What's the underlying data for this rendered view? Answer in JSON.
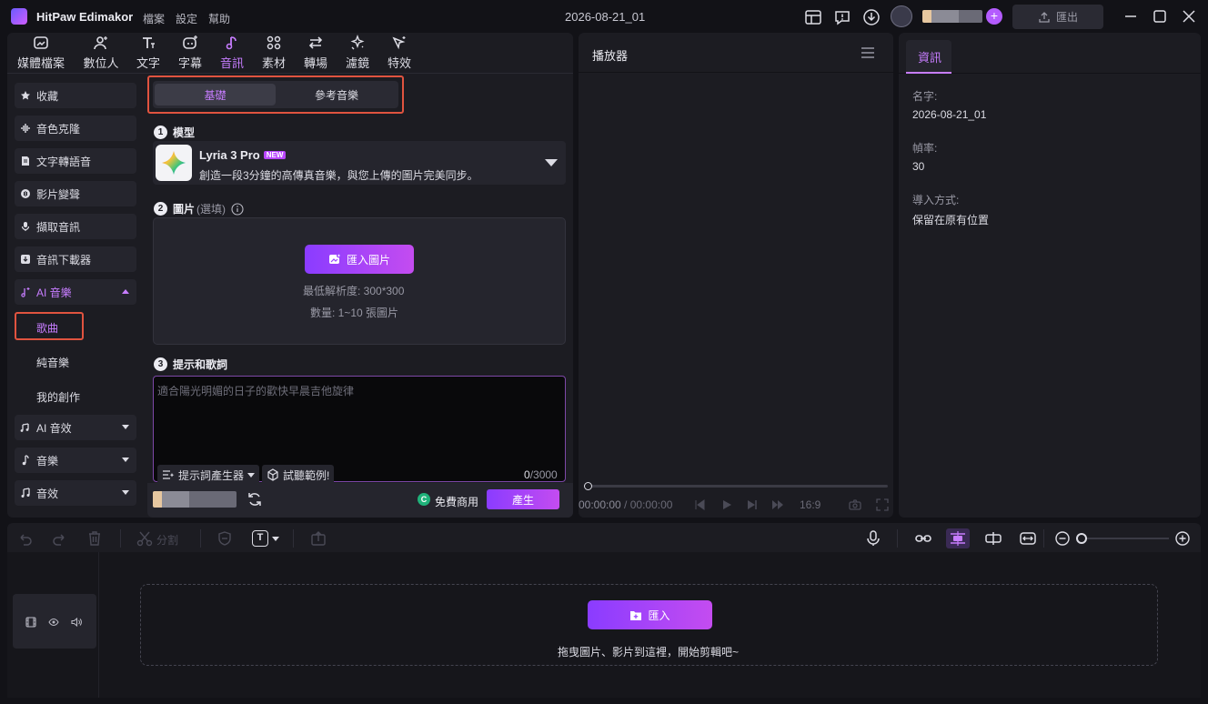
{
  "titlebar": {
    "app_name": "HitPaw Edimakor",
    "menus": [
      "檔案",
      "設定",
      "幫助"
    ],
    "project_name": "2026-08-21_01",
    "export_label": "匯出"
  },
  "tabs": [
    {
      "label": "媒體檔案",
      "icon": "media-icon"
    },
    {
      "label": "數位人",
      "icon": "avatar-person-icon"
    },
    {
      "label": "文字",
      "icon": "text-icon"
    },
    {
      "label": "字幕",
      "icon": "subtitle-icon"
    },
    {
      "label": "音訊",
      "icon": "music-note-icon",
      "active": true
    },
    {
      "label": "素材",
      "icon": "elements-icon"
    },
    {
      "label": "轉場",
      "icon": "transition-icon"
    },
    {
      "label": "濾鏡",
      "icon": "filter-icon"
    },
    {
      "label": "特效",
      "icon": "effects-icon"
    }
  ],
  "sidebar": {
    "items": [
      {
        "label": "收藏",
        "icon": "star-icon"
      },
      {
        "label": "音色克隆",
        "icon": "waveform-icon"
      },
      {
        "label": "文字轉語音",
        "icon": "text-to-speech-icon"
      },
      {
        "label": "影片變聲",
        "icon": "voice-change-icon"
      },
      {
        "label": "擷取音訊",
        "icon": "microphone-icon"
      },
      {
        "label": "音訊下載器",
        "icon": "download-icon"
      },
      {
        "label": "AI 音樂",
        "icon": "ai-music-icon"
      },
      {
        "label": "AI 音效",
        "icon": "ai-sfx-icon"
      },
      {
        "label": "音樂",
        "icon": "music-icon"
      },
      {
        "label": "音效",
        "icon": "sound-effect-icon"
      }
    ],
    "sub_items": [
      "歌曲",
      "純音樂",
      "我的創作"
    ]
  },
  "ai_music": {
    "mode_tabs": [
      "基礎",
      "參考音樂"
    ],
    "section_model": {
      "num": "1",
      "title": "模型"
    },
    "model": {
      "name": "Lyria 3 Pro",
      "badge": "NEW",
      "description": "創造一段3分鐘的高傳真音樂，與您上傳的圖片完美同步。"
    },
    "section_image": {
      "num": "2",
      "title": "圖片",
      "optional": "(選填)"
    },
    "import_image_label": "匯入圖片",
    "min_resolution": "最低解析度:  300*300",
    "quantity": "數量:  1~10 張圖片",
    "section_prompt": {
      "num": "3",
      "title": "提示和歌詞"
    },
    "prompt_placeholder": "適合陽光明媚的日子的歡快早晨吉他旋律",
    "prompt_generator_label": "提示詞產生器",
    "try_sample_label": "試聽範例!",
    "char_count": "0",
    "char_limit": "/3000",
    "free_commercial_label": "免費商用",
    "generate_label": "產生"
  },
  "player": {
    "title": "播放器",
    "time_current": "00:00:00",
    "time_sep": " / ",
    "time_total": "00:00:00",
    "aspect": "16:9",
    "progress": 0
  },
  "info": {
    "tab": "資訊",
    "fields": [
      {
        "label": "名字:",
        "value": "2026-08-21_01"
      },
      {
        "label": "幀率:",
        "value": "30"
      },
      {
        "label": "導入方式:",
        "value": "保留在原有位置"
      }
    ]
  },
  "timeline": {
    "split_label": "分割",
    "import_label": "匯入",
    "drop_hint": "拖曳圖片、影片到這裡，開始剪輯吧~",
    "zoom_level": 0
  },
  "colors": {
    "accent": "#c77dff",
    "gradient_start": "#8a3cff",
    "gradient_end": "#c44cf0",
    "highlight_box": "#e0533f"
  }
}
